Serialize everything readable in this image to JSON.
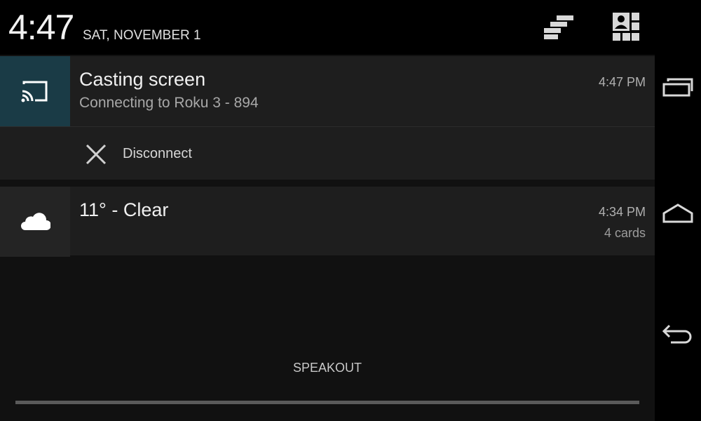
{
  "status": {
    "time": "4:47",
    "date": "SAT, NOVEMBER 1"
  },
  "header": {
    "notif_icon": "clear-all-icon",
    "qs_icon": "quick-settings-icon"
  },
  "notifications": [
    {
      "icon": "cast-icon",
      "title": "Casting screen",
      "subtitle": "Connecting to Roku 3 - 894",
      "time": "4:47 PM",
      "action": {
        "icon": "close-icon",
        "label": "Disconnect"
      },
      "tile_color": "#1a3b46"
    },
    {
      "icon": "cloud-icon",
      "title": "11° - Clear",
      "time": "4:34 PM",
      "meta": "4 cards"
    }
  ],
  "footer": {
    "label": "SPEAKOUT"
  },
  "navbar": {
    "recents_icon": "recents-icon",
    "home_icon": "home-icon",
    "back_icon": "back-icon"
  }
}
